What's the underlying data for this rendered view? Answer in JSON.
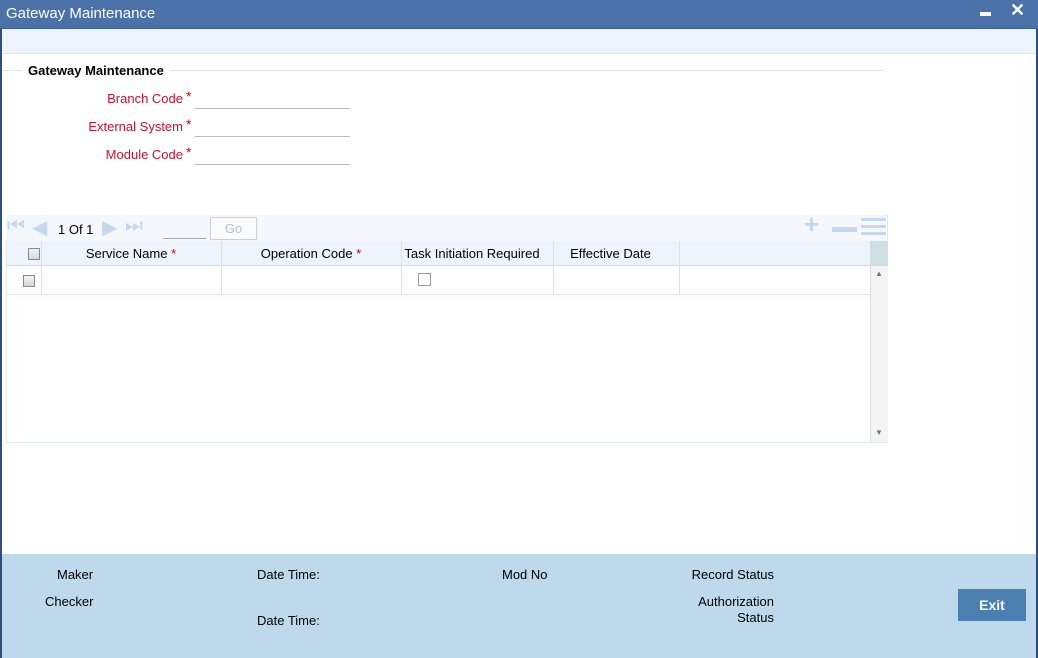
{
  "window": {
    "title": "Gateway Maintenance"
  },
  "section": {
    "title": "Gateway Maintenance"
  },
  "fields": [
    {
      "label": "Branch Code",
      "required": "*",
      "value": ""
    },
    {
      "label": "External System",
      "required": "*",
      "value": ""
    },
    {
      "label": "Module Code",
      "required": "*",
      "value": ""
    }
  ],
  "grid": {
    "pagination": "1 Of 1",
    "go_label": "Go",
    "page_input": "",
    "columns": [
      {
        "label": "Service Name",
        "required": "*"
      },
      {
        "label": "Operation Code",
        "required": "*"
      },
      {
        "label": "Task Initiation Required",
        "required": ""
      },
      {
        "label": "Effective Date",
        "required": ""
      }
    ]
  },
  "footer": {
    "maker": "Maker",
    "checker": "Checker",
    "date_time_1": "Date Time:",
    "date_time_2": "Date Time:",
    "mod_no": "Mod No",
    "record_status": "Record Status",
    "auth_status_1": "Authorization",
    "auth_status_2": "Status",
    "exit_label": "Exit"
  },
  "colors": {
    "titlebar": "#4A72A8",
    "footer": "#BFD9EC",
    "required": "#C8102E",
    "exit": "#4A7FAF"
  }
}
